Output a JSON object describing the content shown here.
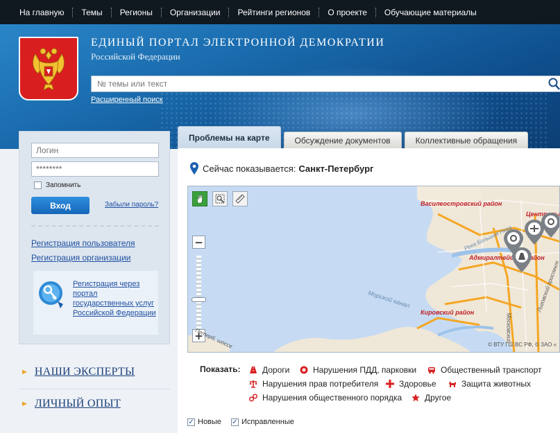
{
  "nav": {
    "items": [
      "На главную",
      "Темы",
      "Регионы",
      "Организации",
      "Рейтинги регионов",
      "О проекте",
      "Обучающие материалы"
    ]
  },
  "header": {
    "title": "ЕДИНЫЙ ПОРТАЛ ЭЛЕКТРОННОЙ ДЕМОКРАТИИ",
    "subtitle": "Российской Федерации",
    "search_placeholder": "№ темы или текст",
    "advanced_search": "Расширенный поиск",
    "emblem_icon": "coat-of-arms-icon",
    "search_icon": "search-icon"
  },
  "login": {
    "login_placeholder": "Логин",
    "password_value": "********",
    "remember_label": "Запомнить",
    "login_button": "Вход",
    "forgot_link": "Забыли пароль?",
    "register_user": "Регистрация пользователя",
    "register_org": "Регистрация организации",
    "gosuslugi_text": "Регистрация через портал государственных услуг Российской Федерации"
  },
  "side_links": {
    "experts": "НАШИ ЭКСПЕРТЫ",
    "experience": "ЛИЧНЫЙ ОПЫТ"
  },
  "tabs": [
    {
      "label": "Проблемы на карте",
      "active": true
    },
    {
      "label": "Обсуждение документов",
      "active": false
    },
    {
      "label": "Коллективные обращения",
      "active": false
    }
  ],
  "map_section": {
    "showing_prefix": "Сейчас показывается:",
    "city": "Санкт-Петербург",
    "labels": {
      "vasileostrovsky": "Василеостровский район",
      "admiralteysky": "Адмиралтейский район",
      "kirovsky": "Кировский район",
      "morskoy_kanal": "Морской канал",
      "tsentralny": "Центральный",
      "reka_neva": "Река Большая Нева",
      "ligovsky": "Лиговский проспект",
      "moskovsky": "Московский",
      "petergof": "Петерб. шоссе"
    },
    "copyright": "© ВТУ ГШ ВС РФ, © ЗАО «"
  },
  "filters": {
    "show_label": "Показать:",
    "categories": [
      {
        "label": "Дороги",
        "color": "#d82020",
        "icon": "road-icon"
      },
      {
        "label": "Нарушения ПДД, парковки",
        "color": "#d82020",
        "icon": "traffic-sign-icon"
      },
      {
        "label": "Общественный транспорт",
        "color": "#d82020",
        "icon": "bus-icon"
      },
      {
        "label": "Нарушения прав потребителя",
        "color": "#d82020",
        "icon": "scales-icon"
      },
      {
        "label": "Здоровье",
        "color": "#d82020",
        "icon": "medical-cross-icon"
      },
      {
        "label": "Защита животных",
        "color": "#d82020",
        "icon": "dog-icon"
      },
      {
        "label": "Нарушения общественного порядка",
        "color": "#d82020",
        "icon": "handcuffs-icon"
      },
      {
        "label": "Другое",
        "color": "#d82020",
        "icon": "star-icon"
      }
    ]
  },
  "checks": {
    "new_label": "Новые",
    "new_checked": true,
    "fixed_label": "Исправленные",
    "fixed_checked": true
  }
}
